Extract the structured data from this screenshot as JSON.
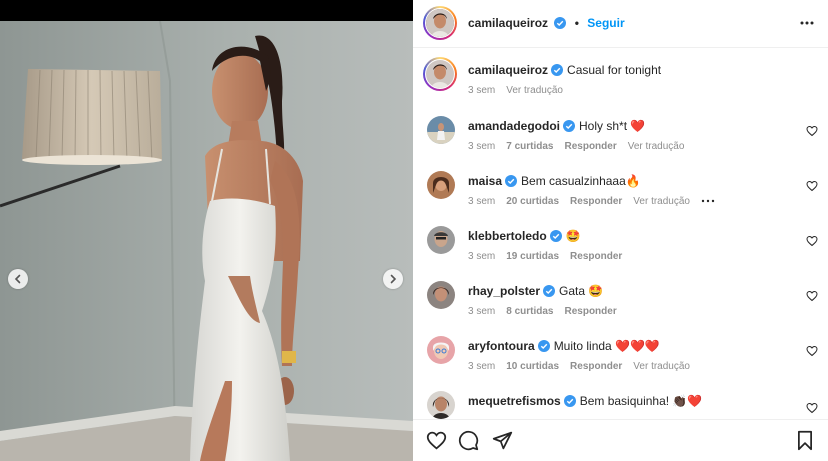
{
  "post": {
    "author": "camilaqueiroz",
    "follow_label": "Seguir",
    "separator": "•",
    "more_icon": "more-horizontal-icon"
  },
  "caption": {
    "user": "camilaqueiroz",
    "text": "Casual for tonight",
    "time": "3 sem",
    "translate": "Ver tradução"
  },
  "comments": [
    {
      "user": "amandadegodoi",
      "text": "Holy sh*t ❤️",
      "time": "3 sem",
      "likes": "7 curtidas",
      "reply": "Responder",
      "translate": "Ver tradução",
      "avatar_color": "#6a8ca8"
    },
    {
      "user": "maisa",
      "text": "Bem casualzinhaaa🔥",
      "time": "3 sem",
      "likes": "20 curtidas",
      "reply": "Responder",
      "translate": "Ver tradução",
      "avatar_color": "#b07a55"
    },
    {
      "user": "klebbertoledo",
      "text": "🤩",
      "time": "3 sem",
      "likes": "19 curtidas",
      "reply": "Responder",
      "avatar_color": "#7c7c7c"
    },
    {
      "user": "rhay_polster",
      "text": "Gata 🤩",
      "time": "3 sem",
      "likes": "8 curtidas",
      "reply": "Responder",
      "avatar_color": "#5a4a44"
    },
    {
      "user": "aryfontoura",
      "text": "Muito linda ❤️❤️❤️",
      "time": "3 sem",
      "likes": "10 curtidas",
      "reply": "Responder",
      "translate": "Ver tradução",
      "avatar_color": "#e7a4a8"
    },
    {
      "user": "mequetrefismos",
      "text": "Bem basiquinha! 👏🏿❤️",
      "time": "",
      "likes": "",
      "reply": "",
      "avatar_color": "#3c3430"
    }
  ],
  "colors": {
    "accent": "#0095f6",
    "verified": "#3897f0",
    "heart": "#ed4956",
    "muted": "#8e8e8e"
  }
}
